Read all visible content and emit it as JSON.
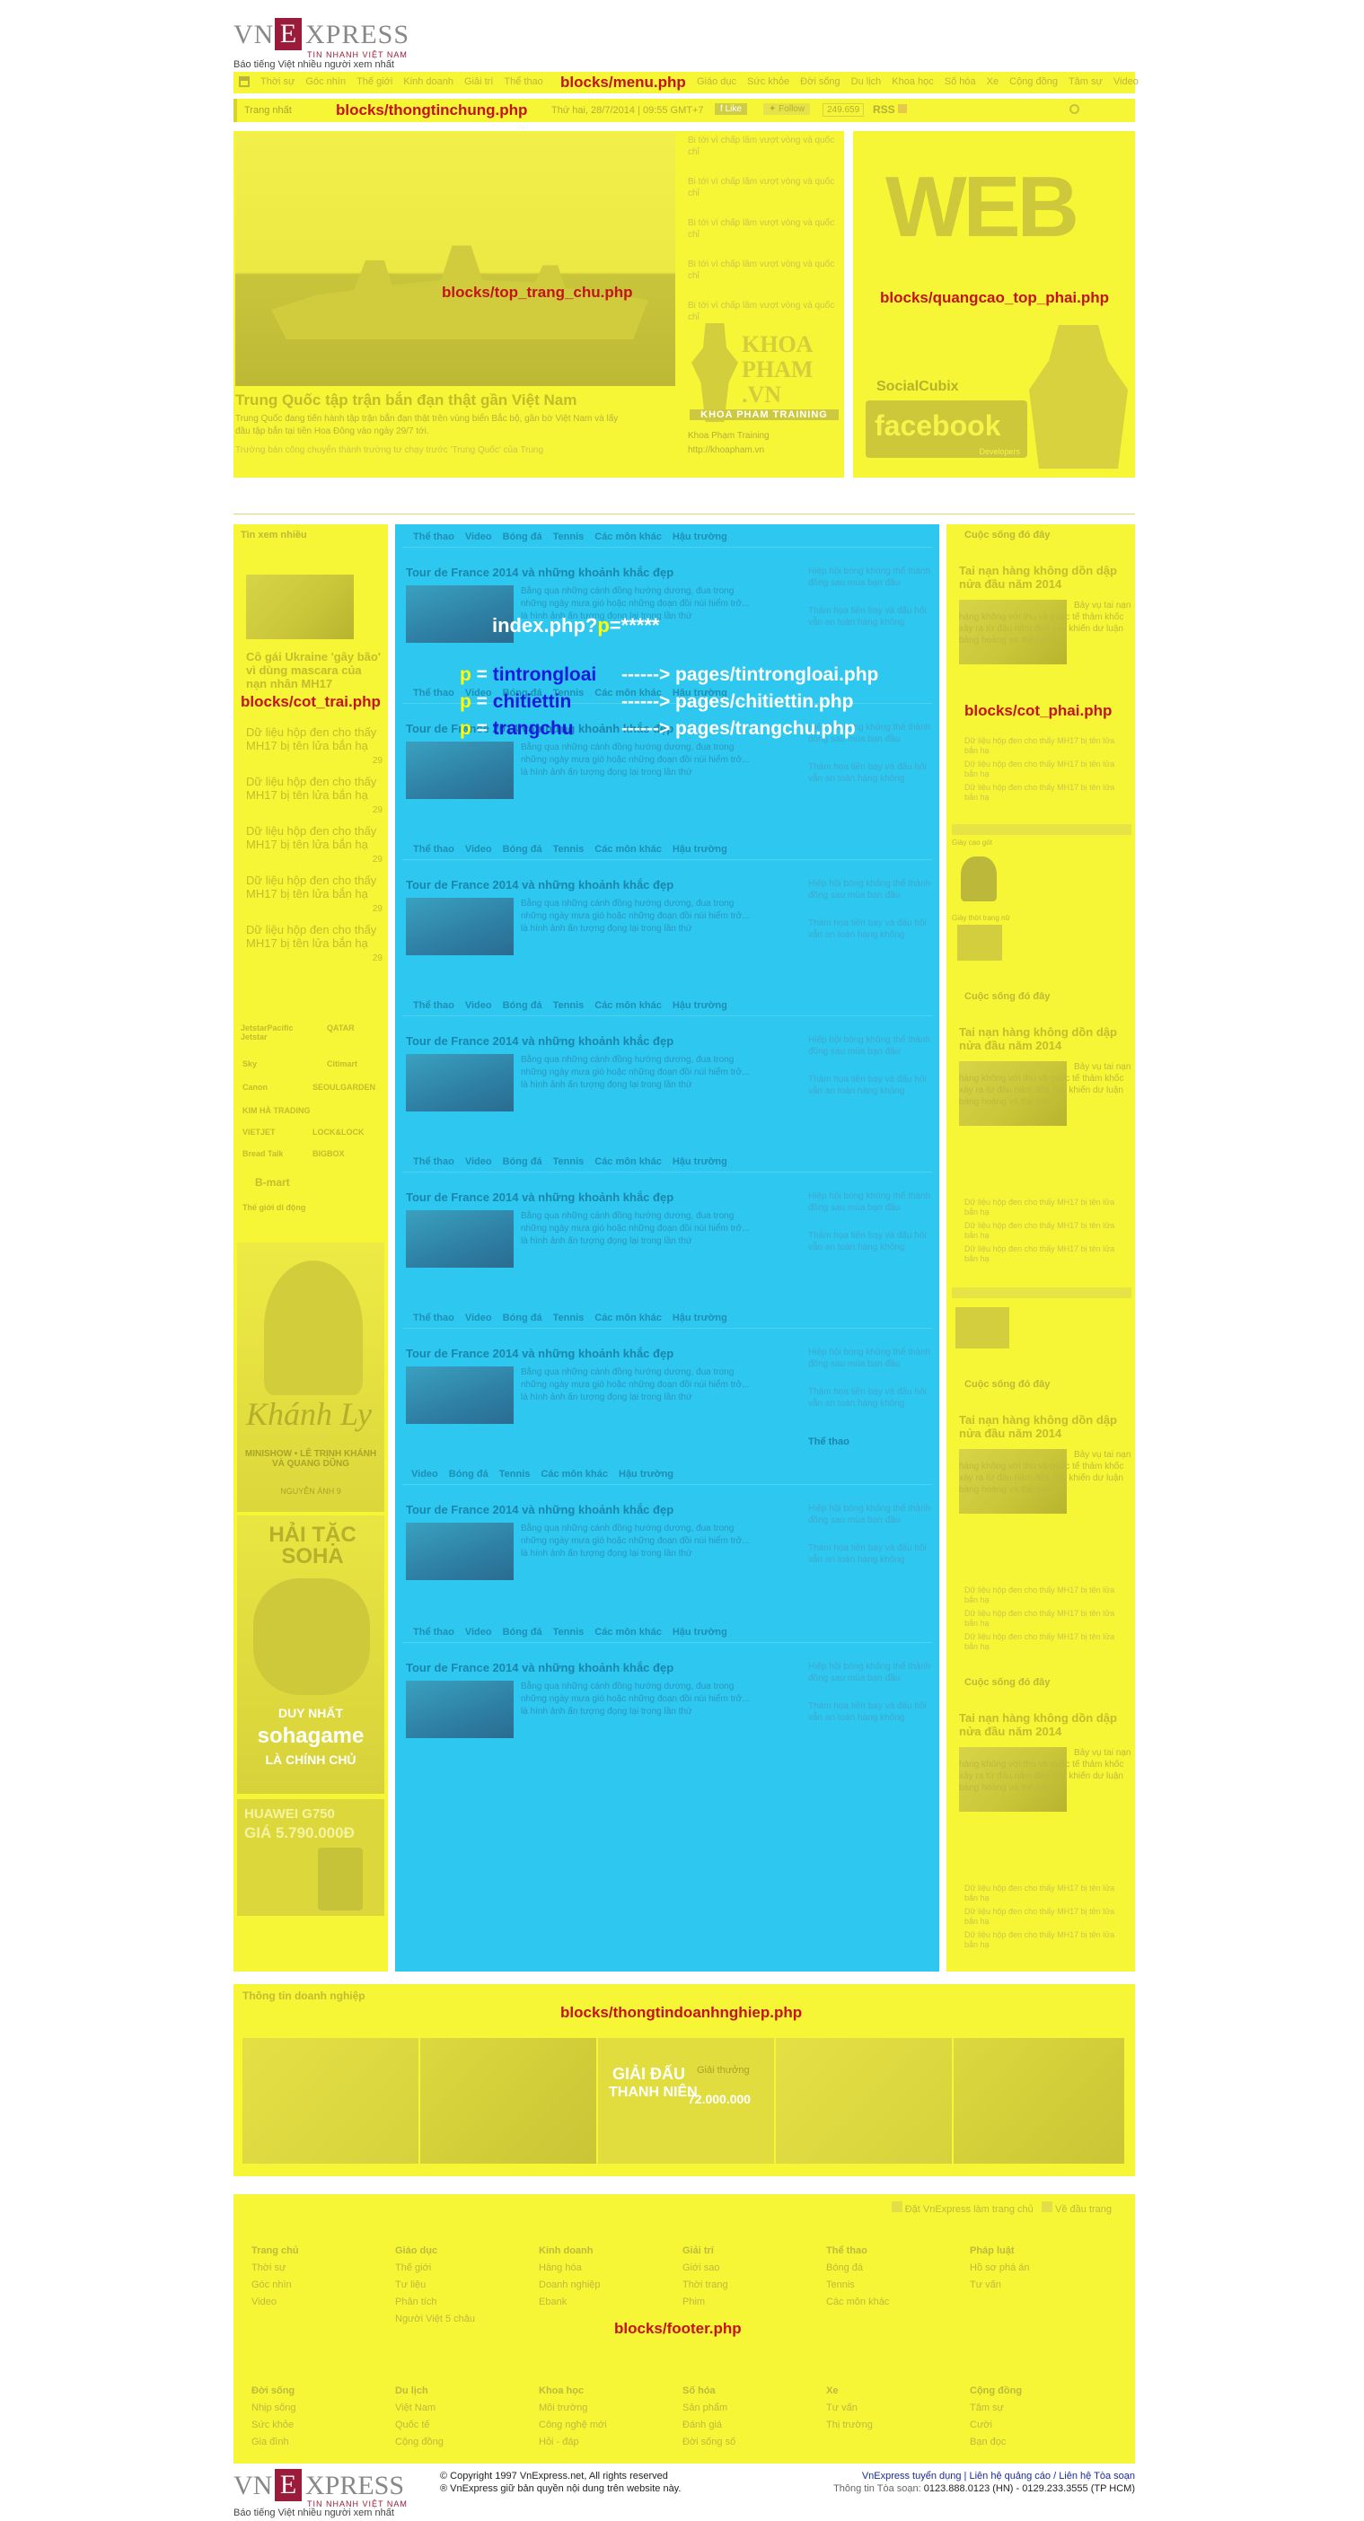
{
  "logo": {
    "left": "VN",
    "right": "XPRESS",
    "mid": "E",
    "tag": "TIN NHANH VIỆT NAM",
    "slogan": "Báo tiếng Việt nhiều người xem nhất"
  },
  "menu": {
    "label": "blocks/menu.php",
    "items": [
      "Thời sự",
      "Góc nhìn",
      "Thế giới",
      "Kinh doanh",
      "Giải trí",
      "Thể thao",
      "Pháp luật",
      "Giáo dục",
      "Sức khỏe",
      "Đời sống",
      "Du lịch",
      "Khoa học",
      "Số hóa",
      "Xe",
      "Cộng đồng",
      "Tâm sự",
      "Video"
    ]
  },
  "info_bar": {
    "label": "blocks/thongtinchung.php",
    "home": "Trang nhất",
    "date": "Thứ hai, 28/7/2014 | 09:55 GMT+7",
    "like": "Like",
    "follow": "Follow",
    "count": "249.659",
    "rss": "RSS"
  },
  "top": {
    "label": "blocks/top_trang_chu.php",
    "headline": "Trung Quốc tập trận bắn đạn thật gần Việt Nam",
    "summary": "Trung Quốc đang tiến hành tập trận bắn đạn thật trên vùng biển Bắc bộ, gần bờ Việt Nam và lấy đầu tập bắn tại tiền Hoa Đông vào ngày 29/7 tới.",
    "related": "Trường bán công chuyển thành trường tư chạy trước 'Trung Quốc' của Trung",
    "side_items": [
      "Bi tới vì chấp lâm vượt vòng và quốc chỉ",
      "Bi tới vì chấp lâm vượt vòng và quốc chỉ",
      "Bi tới vì chấp lâm vượt vòng và quốc chỉ",
      "Bi tới vì chấp lâm vượt vòng và quốc chỉ",
      "Bi tới vì chấp lâm vượt vòng và quốc chỉ"
    ],
    "ad_name": "KHOA PHAM .VN",
    "ad_sub": "KHOA PHAM TRAINING",
    "ad_caption1": "Khoa Phạm Training",
    "ad_caption2": "http://khoapham.vn"
  },
  "top_ad": {
    "label": "blocks/quangcao_top_phai.php",
    "web": "WEB",
    "socialcubix": "SocialCubix",
    "facebook": "facebook",
    "developers": "Developers"
  },
  "left": {
    "label": "blocks/cot_trai.php",
    "title": "Tin xem nhiều",
    "feature": "Cô gái Ukraine 'gây bão' vì dùng mascara của nạn nhân MH17",
    "items": [
      "Dữ liệu hộp đen cho thấy MH17 bị tên lửa bắn hạ",
      "Dữ liệu hộp đen cho thấy MH17 bị tên lửa bắn hạ",
      "Dữ liệu hộp đen cho thấy MH17 bị tên lửa bắn hạ",
      "Dữ liệu hộp đen cho thấy MH17 bị tên lửa bắn hạ",
      "Dữ liệu hộp đen cho thấy MH17 bị tên lửa bắn hạ"
    ],
    "counts": [
      "29",
      "29",
      "29",
      "29",
      "29"
    ],
    "logos": [
      "JetstarPacific Jetstar",
      "QATAR",
      "Sky",
      "Citimart",
      "Canon",
      "SEOULGARDEN",
      "KIM HÀ TRADING",
      "VIETJET",
      "LOCK&LOCK",
      "Bread Talk",
      "BIGBOX",
      "B-mart",
      "Thế giới di động"
    ],
    "ad_khanh_name": "Khánh Ly",
    "ad_khanh_sub": "MINISHOW • LÊ TRỊNH KHÁNH VÀ QUANG DŨNG",
    "ad_khanh_foot": "NGUYỄN ÁNH 9",
    "ad_game_title": "HẢI TẶC SOHA",
    "ad_game_line1": "DUY NHẤT",
    "ad_game_line2": "sohagame",
    "ad_game_line3": "LÀ CHÍNH CHỦ",
    "ad_phone_model": "HUAWEI G750",
    "ad_phone_price": "GIÁ 5.790.000Đ"
  },
  "center": {
    "route": "index.php?p=*****",
    "rules": [
      {
        "p": "p",
        "eq": "=",
        "value": "tintrongloai",
        "arrow": "------> pages/tintrongloai.php"
      },
      {
        "p": "p",
        "eq": "=",
        "value": "chitiettin",
        "arrow": "------> pages/chitiettin.php"
      },
      {
        "p": "p",
        "eq": "=",
        "value": "trangchu",
        "arrow": "------> pages/trangchu.php"
      }
    ],
    "tabs": [
      "Thể thao",
      "Video",
      "Bóng đá",
      "Tennis",
      "Các môn khác",
      "Hậu trường"
    ],
    "tabs_short": [
      "Video",
      "Bóng đá",
      "Tennis",
      "Các môn khác",
      "Hậu trường"
    ],
    "story_title": "Tour de France 2014 và những khoảnh khắc đẹp",
    "story_text": "Bằng qua những cánh đồng hướng dương, đua trong những ngày mưa gió hoặc những đoạn đồi núi hiểm trở... là hình ảnh ấn tượng đọng lại trong lần thứ",
    "side1": "Hiệp hội bóng không thể thành đồng sau mùa bạn đầu",
    "side2": "Thảm họa tiền bay và đấu hôi vẫn an toàn hàng không",
    "side_label": "Thể thao"
  },
  "right": {
    "label": "blocks/cot_phai.php",
    "title": "Cuộc sống đó đây",
    "headline": "Tai nạn hàng không dồn dập nửa đầu năm 2014",
    "desc": "Bảy vụ tai nạn hàng không với thu và quốc tế thảm khốc xảy ra từ đầu năm đến nay khiến dư luận bàng hoàng và thế nào.",
    "items": [
      "Dữ liệu hộp đen cho thấy MH17 bị tên lửa bắn hạ",
      "Dữ liệu hộp đen cho thấy MH17 bị tên lửa bắn hạ",
      "Dữ liệu hộp đen cho thấy MH17 bị tên lửa bắn hạ",
      "Dữ liệu hộp đen cho thấy MH17 bị tên lửa bắn hạ"
    ],
    "widget1": "Giày cao gót",
    "widget2": "Giày thời trang nữ"
  },
  "business": {
    "label": "blocks/thongtindoanhnghiep.php",
    "title": "Thông tin doanh nghiệp",
    "banner_mid1": "GIẢI ĐẤU",
    "banner_mid2": "THANH NIÊN",
    "banner_prize_lbl": "Giải thưởng",
    "banner_prize": "72.000.000"
  },
  "footer": {
    "label": "blocks/footer.php",
    "top_links": [
      "Đặt VnExpress làm trang chủ",
      "Về đầu trang"
    ],
    "col1": [
      "Trang chủ",
      "Thời sự",
      "Góc nhìn",
      "Video"
    ],
    "col2": [
      "Giáo dục",
      "Thế giới",
      "Tư liệu",
      "Phân tích",
      "Người Việt 5 châu"
    ],
    "col3": [
      "Kinh doanh",
      "Hàng hóa",
      "Doanh nghiệp",
      "Ebank"
    ],
    "col4": [
      "Giải trí",
      "Giới sao",
      "Thời trang",
      "Phim"
    ],
    "col5": [
      "Thể thao",
      "Bóng đá",
      "Tennis",
      "Các môn khác"
    ],
    "col6": [
      "Pháp luật",
      "Hồ sơ phá án",
      "Tư vấn"
    ],
    "col7": [
      "Đời sống",
      "Nhịp sống",
      "Sức khỏe",
      "Gia đình"
    ],
    "col8": [
      "Du lịch",
      "Việt Nam",
      "Quốc tế",
      "Cộng đồng"
    ],
    "col9": [
      "Khoa học",
      "Môi trường",
      "Công nghệ mới",
      "Hỏi - đáp"
    ],
    "col10": [
      "Số hóa",
      "Sản phẩm",
      "Đánh giá",
      "Đời sống số"
    ],
    "col11": [
      "Xe",
      "Tư vấn",
      "Thị trường"
    ],
    "col12": [
      "Cộng đồng",
      "Tâm sự",
      "Cười",
      "Bạn đọc"
    ]
  },
  "bottom": {
    "copy1": "© Copyright 1997 VnExpress.net, All rights reserved",
    "copy2": "® VnExpress giữ bản quyền nội dung trên website này.",
    "link1": "VnExpress tuyển dụng",
    "sep1": " | ",
    "link2": "Liên hệ quảng cáo",
    "sep2": " / ",
    "link3": "Liên hệ Tòa soạn",
    "contact_lbl": "Thông tin Tòa soạn:",
    "contact": "0123.888.0123 (HN) - 0129.233.3555 (TP HCM)"
  }
}
